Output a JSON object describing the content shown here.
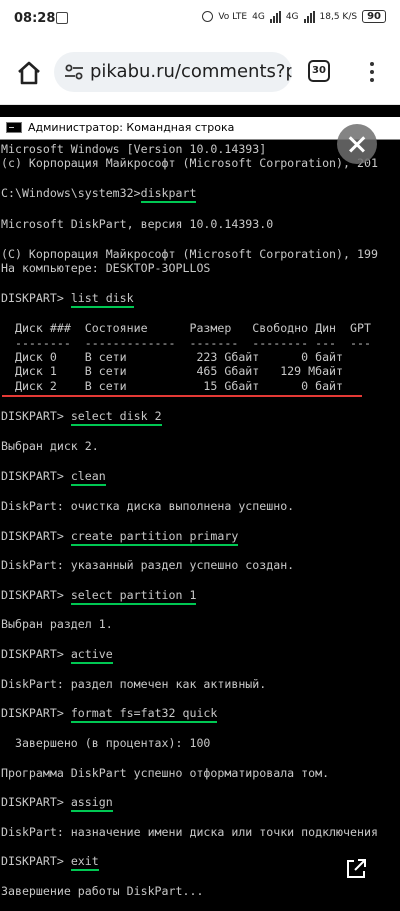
{
  "status_bar": {
    "time": "08:28",
    "network_labels": [
      "Vo LTE",
      "4G",
      "4G"
    ],
    "speed": "18,5 K/S",
    "battery": "90"
  },
  "browser": {
    "url": "pikabu.ru/comments?pag",
    "tab_count": "30"
  },
  "console": {
    "window_title": "Администратор: Командная строка",
    "highlight_color": "#00c853",
    "underline_color": "#e53935",
    "lines": [
      "Microsoft Windows [Version 10.0.14393]",
      "(c) Корпорация Майкрософт (Microsoft Corporation), 201",
      "C:\\Windows\\system32>",
      "diskpart",
      "Microsoft DiskPart, версия 10.0.14393.0",
      "(C) Корпорация Майкрософт (Microsoft Corporation), 199",
      "На компьютере: DESKTOP-3OPLLOS",
      "DISKPART> ",
      "list disk",
      "  Диск ###  Состояние      Размер   Свободно Дин  GPT",
      "  --------  -------------  -------  -------- ---  ---",
      "  Диск 0    В сети          223 Gбайт      0 байт",
      "  Диск 1    В сети          465 Gбайт   129 Mбайт",
      "  Диск 2    В сети           15 Gбайт      0 байт",
      "DISKPART> ",
      "select disk 2",
      "Выбран диск 2.",
      "DISKPART> ",
      "clean",
      "DiskPart: очистка диска выполнена успешно.",
      "DISKPART> ",
      "create partition primary",
      "DiskPart: указанный раздел успешно создан.",
      "DISKPART> ",
      "select partition 1",
      "Выбран раздел 1.",
      "DISKPART> ",
      "active",
      "DiskPart: раздел помечен как активный.",
      "DISKPART> ",
      "format fs=fat32 quick",
      "  Завершено (в процентах): 100",
      "Программа DiskPart успешно отформатировала том.",
      "DISKPART> ",
      "assign",
      "DiskPart: назначение имени диска или точки подключения",
      "DISKPART> ",
      "exit",
      "Завершение работы DiskPart..."
    ]
  }
}
